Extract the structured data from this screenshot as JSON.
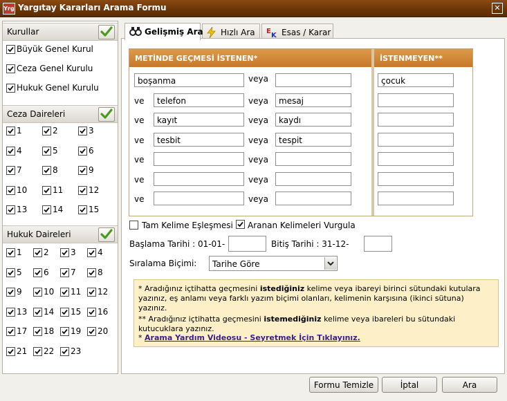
{
  "window": {
    "logo": "Yrg",
    "title": "Yargıtay Kararları Arama Formu",
    "close": "✕"
  },
  "sidebar": {
    "kurullar": {
      "label": "Kurullar",
      "items": [
        "Büyük Genel Kurul",
        "Ceza Genel Kurulu",
        "Hukuk Genel Kurulu"
      ]
    },
    "ceza": {
      "label": "Ceza Daireleri",
      "items": [
        "1",
        "2",
        "3",
        "4",
        "5",
        "6",
        "7",
        "8",
        "9",
        "10",
        "11",
        "12",
        "13",
        "14",
        "15"
      ]
    },
    "hukuk": {
      "label": "Hukuk Daireleri",
      "items": [
        "1",
        "2",
        "3",
        "4",
        "5",
        "6",
        "7",
        "8",
        "9",
        "10",
        "11",
        "12",
        "13",
        "14",
        "15",
        "16",
        "17",
        "18",
        "19",
        "20",
        "21",
        "22",
        "23"
      ]
    }
  },
  "tabs": [
    {
      "label": "Gelişmiş Ara",
      "icon": "binoculars-icon"
    },
    {
      "label": "Hızlı Ara",
      "icon": "lightning-icon"
    },
    {
      "label": "Esas / Karar",
      "icon": "ek-icon"
    }
  ],
  "grid": {
    "include_header": "METİNDE GEÇMESİ İSTENEN*",
    "exclude_header": "İSTENMEYEN**",
    "ve": "ve",
    "veya": "veya",
    "rows": [
      {
        "first": "boşanma",
        "second": "",
        "exclude": "çocuk"
      },
      {
        "first": "telefon",
        "second": "mesaj",
        "exclude": ""
      },
      {
        "first": "kayıt",
        "second": "kaydı",
        "exclude": ""
      },
      {
        "first": "tesbit",
        "second": "tespit",
        "exclude": ""
      },
      {
        "first": "",
        "second": "",
        "exclude": ""
      },
      {
        "first": "",
        "second": "",
        "exclude": ""
      },
      {
        "first": "",
        "second": "",
        "exclude": ""
      }
    ]
  },
  "options": {
    "exact_match": {
      "label": "Tam Kelime Eşleşmesi",
      "checked": false
    },
    "highlight": {
      "label": "Aranan Kelimeleri Vurgula",
      "checked": true
    }
  },
  "dates": {
    "start_label": "Başlama Tarihi : 01-01-",
    "start_value": "",
    "end_label": "Bitiş Tarihi : 31-12-",
    "end_value": ""
  },
  "sort": {
    "label": "Sıralama Biçimi:",
    "value": "Tarihe Göre"
  },
  "info": {
    "p1_a": "* Aradığınız içtihatta geçmesini ",
    "p1_b": "istediğiniz",
    "p1_c": " kelime veya ibareyi birinci sütundaki kutulara yazınız, eş anlamı veya farklı yazım biçimi olanları, kelimenin karşısına (ikinci sütuna) yazınız.",
    "p2_a": "** Aradığınız içtihatta geçmesini ",
    "p2_b": "istemediğiniz",
    "p2_c": " kelime veya ibareleri bu sütundaki kutucuklara yazınız.",
    "p3_star": "* ",
    "p3_link": "Arama Yardım Videosu - Seyretmek İçin Tıklayınız."
  },
  "buttons": {
    "clear": "Formu Temizle",
    "cancel": "İptal",
    "search": "Ara"
  }
}
